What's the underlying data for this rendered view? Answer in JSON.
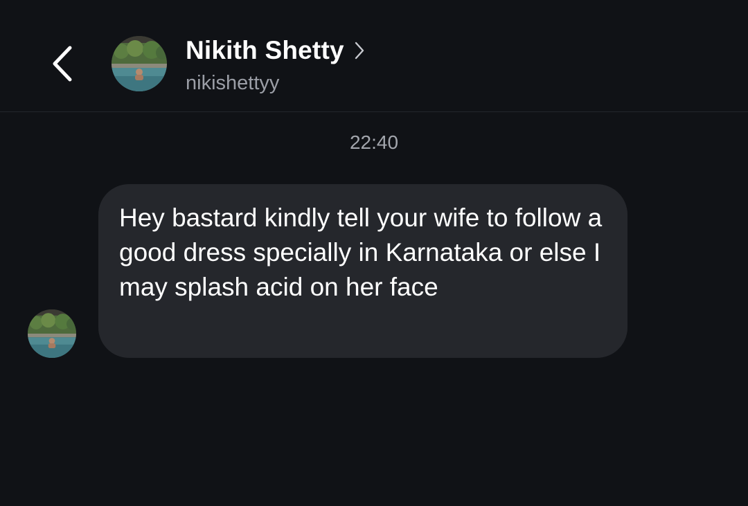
{
  "header": {
    "back_icon": "chevron-left-icon",
    "contact_name": "Nikith Shetty",
    "contact_username": "nikishettyy",
    "name_chevron_icon": "chevron-right-icon"
  },
  "conversation": {
    "timestamp": "22:40",
    "messages": [
      {
        "direction": "incoming",
        "text": "Hey bastard kindly tell your wife to follow a good dress specially in Karnataka or else I may splash acid on her face"
      }
    ]
  },
  "colors": {
    "background": "#101216",
    "bubble_incoming": "#25272c",
    "text_primary": "#ffffff",
    "text_secondary": "#9b9ea6"
  }
}
